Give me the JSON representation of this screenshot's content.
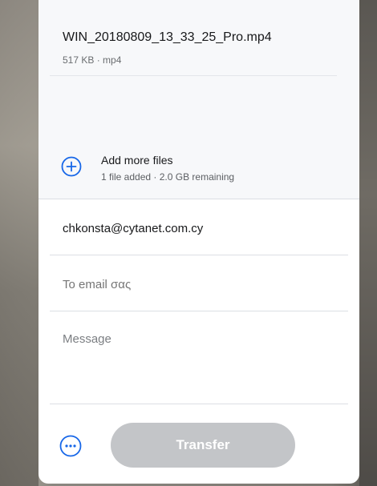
{
  "file": {
    "name": "WIN_20180809_13_33_25_Pro.mp4",
    "meta": "517 KB · mp4"
  },
  "add_more": {
    "title": "Add more files",
    "subtitle": "1 file added · 2.0 GB remaining",
    "icon": "plus-circle-icon"
  },
  "form": {
    "email_value": "chkonsta@cytanet.com.cy",
    "to_placeholder": "To email σας",
    "message_placeholder": "Message"
  },
  "footer": {
    "more_icon": "more-options-icon",
    "transfer_label": "Transfer"
  },
  "colors": {
    "accent": "#1767e8",
    "button_disabled": "#c3c5c8"
  }
}
